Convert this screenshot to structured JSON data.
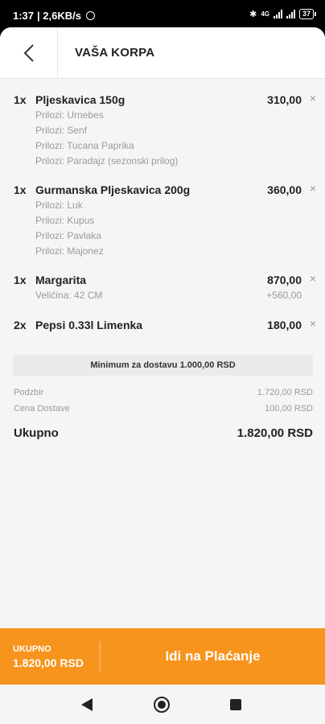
{
  "status_bar": {
    "time": "1:37",
    "network_speed": "| 2,6KB/s",
    "network_type": "4G",
    "battery": "37"
  },
  "header": {
    "title": "VAŠA KORPA"
  },
  "cart": {
    "items": [
      {
        "qty": "1x",
        "name": "Pljeskavica 150g",
        "price": "310,00",
        "addons": [
          "Prilozi: Urnebes",
          "Prilozi: Senf",
          "Prilozi: Tucana Paprika",
          "Prilozi: Paradajz (sezonski prilog)"
        ]
      },
      {
        "qty": "1x",
        "name": "Gurmanska Pljeskavica 200g",
        "price": "360,00",
        "addons": [
          "Prilozi: Luk",
          "Prilozi: Kupus",
          "Prilozi: Pavlaka",
          "Prilozi: Majonez"
        ]
      },
      {
        "qty": "1x",
        "name": "Margarita",
        "price": "870,00",
        "addons": [
          "Veličina: 42 CM"
        ],
        "addon_price": "+560,00"
      },
      {
        "qty": "2x",
        "name": "Pepsi 0.33l Limenka",
        "price": "180,00",
        "addons": []
      }
    ]
  },
  "remove_glyph": "×",
  "minimum_notice": "Minimum za dostavu 1.000,00 RSD",
  "summary": {
    "subtotal_label": "Podzbir",
    "subtotal_value": "1.720,00 RSD",
    "delivery_label": "Cena Dostave",
    "delivery_value": "100,00 RSD",
    "total_label": "Ukupno",
    "total_value": "1.820,00 RSD"
  },
  "footer": {
    "total_label": "UKUPNO",
    "total_value": "1.820,00 RSD",
    "checkout_label": "Idi na Plaćanje"
  },
  "colors": {
    "accent": "#f7941d",
    "background": "#f5f5f5"
  }
}
